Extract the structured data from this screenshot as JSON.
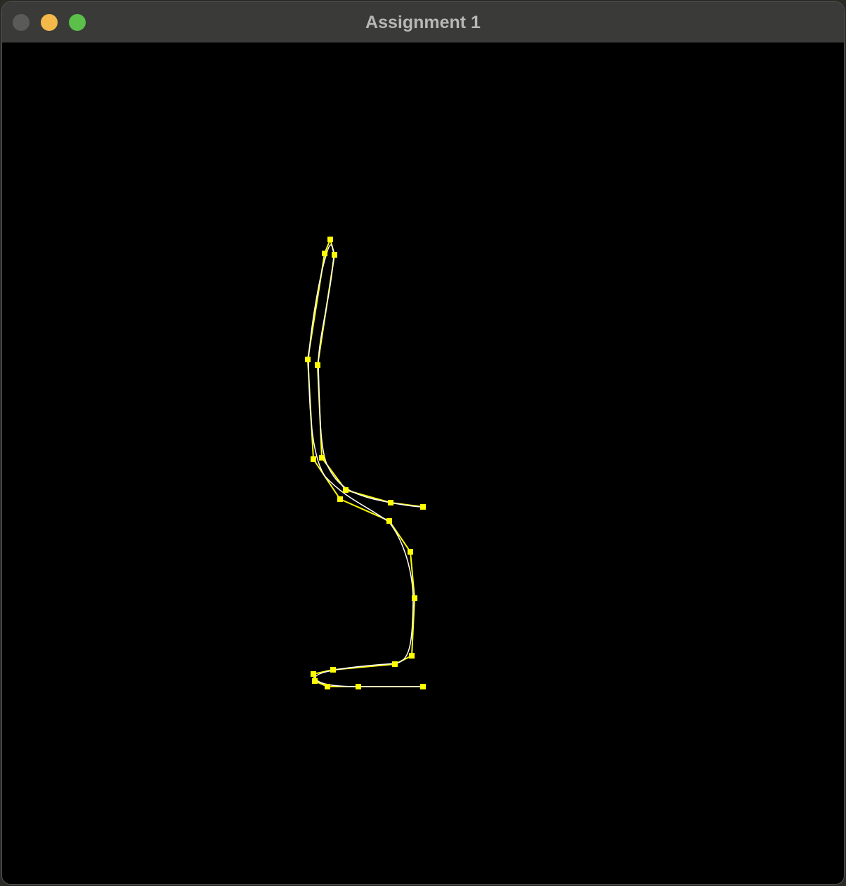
{
  "window": {
    "title": "Assignment 1"
  },
  "titlebar_buttons": {
    "close": "close-button",
    "minimize": "minimize-button",
    "zoom": "zoom-button"
  },
  "colors": {
    "background": "#000000",
    "curve": "#ffffff",
    "control": "#ffff00",
    "titlebar": "#3a3a39",
    "title_text": "#b7b7b6"
  }
}
